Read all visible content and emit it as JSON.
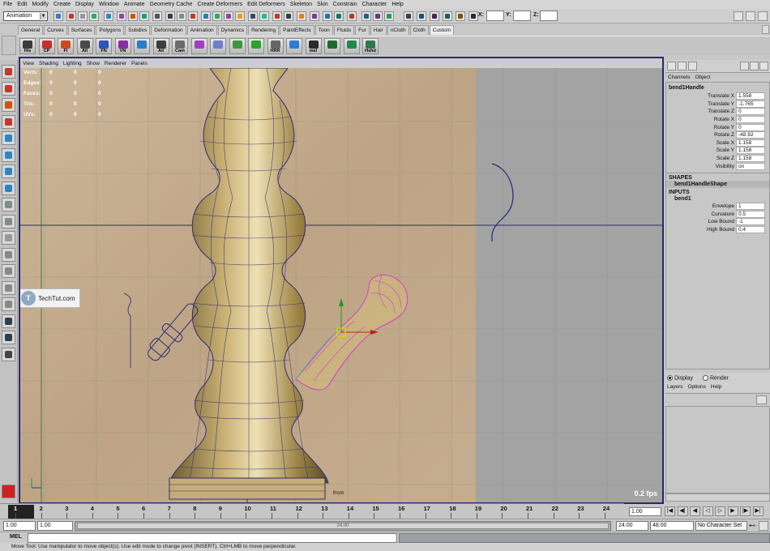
{
  "menu": [
    "File",
    "Edit",
    "Modify",
    "Create",
    "Display",
    "Window",
    "Animate",
    "Geometry Cache",
    "Create Deformers",
    "Edit Deformers",
    "Skeleton",
    "Skin",
    "Constrain",
    "Character",
    "Help"
  ],
  "status": {
    "mode": "Animation",
    "coord_labels": {
      "x": "X:",
      "y": "Y:",
      "z": "Z:"
    }
  },
  "shelf_tabs": [
    "General",
    "Curves",
    "Surfaces",
    "Polygons",
    "Subdivs",
    "Deformation",
    "Animation",
    "Dynamics",
    "Rendering",
    "PaintEffects",
    "Toon",
    "Fluids",
    "Fur",
    "Hair",
    "nCloth",
    "Cloth",
    "Custom"
  ],
  "shelf_active": "Custom",
  "shelf_icons": [
    {
      "name": "hist-icon",
      "label": "His",
      "color": "#3c3c3c"
    },
    {
      "name": "cp-icon",
      "label": "CP",
      "color": "#c73030"
    },
    {
      "name": "fi-icon",
      "label": "FI",
      "color": "#c94c1c"
    },
    {
      "name": "all-icon",
      "label": "All",
      "color": "#4a4a4a"
    },
    {
      "name": "fn-icon",
      "label": "FN",
      "color": "#2f56b8"
    },
    {
      "name": "vn-icon",
      "label": "VN",
      "color": "#8a2fa0"
    },
    {
      "name": "cube-icon",
      "label": "",
      "color": "#2a7dc6"
    },
    {
      "name": "all2-icon",
      "label": "All",
      "color": "#3d3d3d"
    },
    {
      "name": "cam-icon",
      "label": "Cam",
      "color": "#6b6b6b"
    },
    {
      "name": "sphere-icon",
      "label": "",
      "color": "#a040c0"
    },
    {
      "name": "target-icon",
      "label": "",
      "color": "#6a7fd0"
    },
    {
      "name": "move-icon",
      "label": "",
      "color": "#3c9a3c"
    },
    {
      "name": "play-icon",
      "label": "",
      "color": "#2aa52a"
    },
    {
      "name": "hrr-icon",
      "label": "HRR",
      "color": "#666"
    },
    {
      "name": "cross-icon",
      "label": "",
      "color": "#2e7bd2"
    },
    {
      "name": "mel-icon",
      "label": "mel",
      "color": "#2b2b2b"
    },
    {
      "name": "joint-icon",
      "label": "",
      "color": "#1d6b2c"
    },
    {
      "name": "arrow-down-icon",
      "label": "",
      "color": "#1f8a4e"
    },
    {
      "name": "hshd-icon",
      "label": "Hshd",
      "color": "#2a7a4a"
    }
  ],
  "panel_menu": [
    "View",
    "Shading",
    "Lighting",
    "Show",
    "Renderer",
    "Panels"
  ],
  "hud": [
    {
      "k": "Verts:",
      "v": [
        "0",
        "0",
        "0"
      ]
    },
    {
      "k": "Edges:",
      "v": [
        "0",
        "0",
        "0"
      ]
    },
    {
      "k": "Faces:",
      "v": [
        "0",
        "0",
        "0"
      ]
    },
    {
      "k": "Tris:",
      "v": [
        "0",
        "0",
        "0"
      ]
    },
    {
      "k": "UVs:",
      "v": [
        "0",
        "0",
        "0"
      ]
    }
  ],
  "viewport": {
    "fps": "0.2 fps",
    "camera": "front"
  },
  "watermark": {
    "logo": "T",
    "text": "TechTut.com"
  },
  "channel_tabs": [
    "Channels",
    "Object"
  ],
  "channel": {
    "node": "bend1Handle",
    "attrs": [
      {
        "l": "Translate X",
        "v": "1.558"
      },
      {
        "l": "Translate Y",
        "v": "-1.765"
      },
      {
        "l": "Translate Z",
        "v": "0"
      },
      {
        "l": "Rotate X",
        "v": "0"
      },
      {
        "l": "Rotate Y",
        "v": "0"
      },
      {
        "l": "Rotate Z",
        "v": "-48.92"
      },
      {
        "l": "Scale X",
        "v": "1.158"
      },
      {
        "l": "Scale Y",
        "v": "1.158"
      },
      {
        "l": "Scale Z",
        "v": "1.158"
      },
      {
        "l": "Visibility",
        "v": "on"
      }
    ],
    "shapes_label": "SHAPES",
    "shape": "bend1HandleShape",
    "inputs_label": "INPUTS",
    "input": "bend1",
    "input_attrs": [
      {
        "l": "Envelope",
        "v": "1"
      },
      {
        "l": "Curvature",
        "v": "0.5"
      },
      {
        "l": "Low Bound",
        "v": "-1"
      },
      {
        "l": "High Bound",
        "v": "0.4"
      }
    ]
  },
  "layers": {
    "display": "Display",
    "render": "Render",
    "menu": [
      "Layers",
      "Options",
      "Help"
    ]
  },
  "timeline": {
    "ticks": [
      "1",
      "2",
      "3",
      "4",
      "5",
      "6",
      "7",
      "8",
      "9",
      "10",
      "11",
      "12",
      "13",
      "14",
      "15",
      "16",
      "17",
      "18",
      "19",
      "20",
      "21",
      "22",
      "23",
      "24"
    ],
    "current": "1.00"
  },
  "range": {
    "start": "1.00",
    "inner_start": "1.00",
    "end": "24.00",
    "outer_end": "48.00",
    "thumb": "24.00",
    "char_set": "No Character Set"
  },
  "command": {
    "label": "MEL"
  },
  "help": "Move Tool: Use manipulator to move object(s). Use edit mode to change pivot (INSERT). Ctrl+LMB to move perpendicular."
}
